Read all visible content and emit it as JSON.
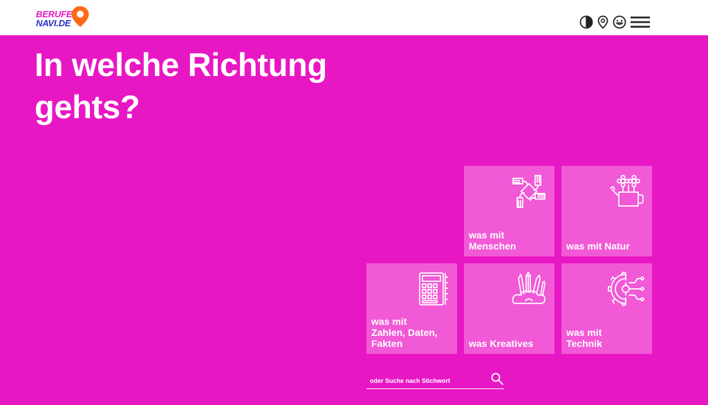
{
  "header": {
    "logo": {
      "line1": "BERUFE",
      "line2": "NAVI.DE"
    },
    "icons": [
      "contrast-icon",
      "location-pin-icon",
      "smiley-icon",
      "menu-icon"
    ]
  },
  "headline": "In welche Richtung gehts?",
  "tiles": [
    {
      "label": "was mit\nMenschen",
      "icon": "hands-together-icon"
    },
    {
      "label": "was mit Natur",
      "icon": "watering-can-flowers-icon"
    },
    {
      "label": "was mit\nZahlen, Daten,\nFakten",
      "icon": "calculator-icon"
    },
    {
      "label": "was Kreatives",
      "icon": "art-supplies-icon"
    },
    {
      "label": "was mit\nTechnik",
      "icon": "circuit-gear-icon"
    }
  ],
  "search": {
    "placeholder": "oder Suche nach Stichwort",
    "value": ""
  },
  "colors": {
    "background": "#e817c4",
    "tile": "#f159d6",
    "header": "#ffffff",
    "logo_pink": "#e817c4",
    "logo_blue": "#2a2fc7",
    "logo_pin": "#ff6a1a"
  }
}
